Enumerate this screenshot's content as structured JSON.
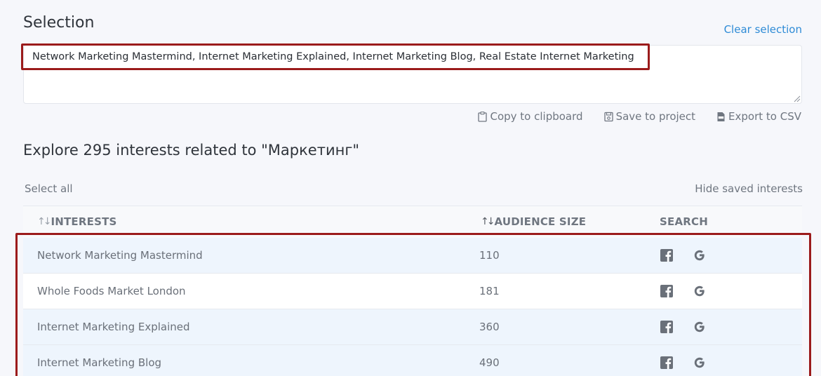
{
  "selection": {
    "title": "Selection",
    "clear_label": "Clear selection",
    "text": "Network Marketing Mastermind, Internet Marketing Explained, Internet Marketing Blog, Real Estate Internet Marketing",
    "actions": {
      "copy_label": "Copy to clipboard",
      "save_label": "Save to project",
      "export_label": "Export to CSV"
    }
  },
  "explore": {
    "title": "Explore 295 interests related to \"Маркетинг\"",
    "select_all_label": "Select all",
    "hide_saved_label": "Hide saved interests"
  },
  "table": {
    "headers": {
      "interests": "INTERESTS",
      "audience": "AUDIENCE SIZE",
      "search": "SEARCH"
    },
    "rows": [
      {
        "name": "Network Marketing Mastermind",
        "size": "110"
      },
      {
        "name": "Whole Foods Market London",
        "size": "181"
      },
      {
        "name": "Internet Marketing Explained",
        "size": "360"
      },
      {
        "name": "Internet Marketing Blog",
        "size": "490"
      }
    ]
  },
  "colors": {
    "accent_link": "#2e8bd6",
    "highlight_border": "#9b1b1b",
    "row_alt": "#eef5fd"
  },
  "icons": [
    "clipboard-icon",
    "floppy-icon",
    "csv-file-icon",
    "facebook-icon",
    "google-icon",
    "sort-icon"
  ]
}
